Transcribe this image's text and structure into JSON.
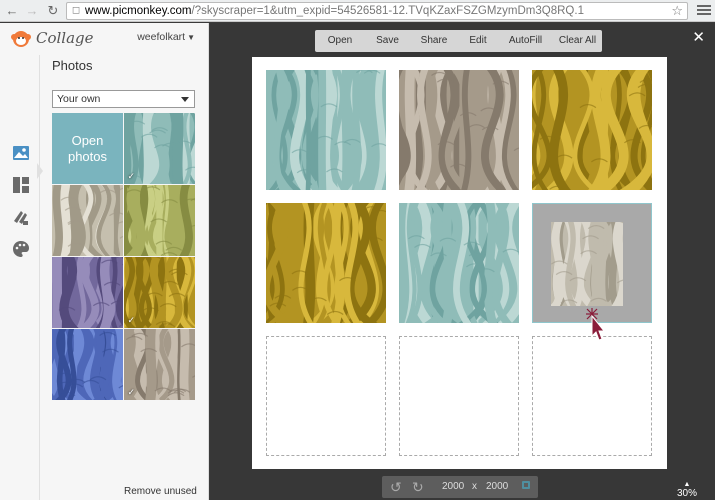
{
  "browser": {
    "url_host": "www.picmonkey.com",
    "url_rest": "/?skyscraper=1&utm_expid=54526581-12.TVqKZaxFSZGMzymDm3Q8RQ.1"
  },
  "app": {
    "logo_text": "Collage",
    "username": "weefolkart"
  },
  "panel": {
    "title": "Photos",
    "source_select": "Your own",
    "open_photos_label": "Open photos",
    "remove_unused_label": "Remove unused",
    "thumbs": [
      {
        "color": "aqua",
        "checked": true
      },
      {
        "color": "cream",
        "checked": false
      },
      {
        "color": "lime",
        "checked": false
      },
      {
        "color": "purple",
        "checked": false
      },
      {
        "color": "mustard",
        "checked": true
      },
      {
        "color": "blue",
        "checked": false
      },
      {
        "color": "taupe",
        "checked": true
      }
    ]
  },
  "toolbar": {
    "open": "Open",
    "save": "Save",
    "share": "Share",
    "edit": "Edit",
    "autofill": "AutoFill",
    "clear_all": "Clear All"
  },
  "canvas": {
    "width": "2000",
    "x": "x",
    "height": "2000",
    "zoom": "30%"
  },
  "colors": {
    "aqua": [
      "#bcd8d4",
      "#8fbcb8",
      "#6fa3a0"
    ],
    "taupe": [
      "#c6bcae",
      "#a59a8a",
      "#857a6c"
    ],
    "mustard": [
      "#d8b83c",
      "#b39422",
      "#8d7310"
    ],
    "cream": [
      "#e4e0d4",
      "#c5bfae",
      "#a19a88"
    ],
    "lime": [
      "#c9cf84",
      "#a8ae5e",
      "#868c42"
    ],
    "purple": [
      "#968cba",
      "#72689c",
      "#544a7c"
    ],
    "blue": [
      "#6e89d6",
      "#4e67b8",
      "#364e98"
    ]
  }
}
